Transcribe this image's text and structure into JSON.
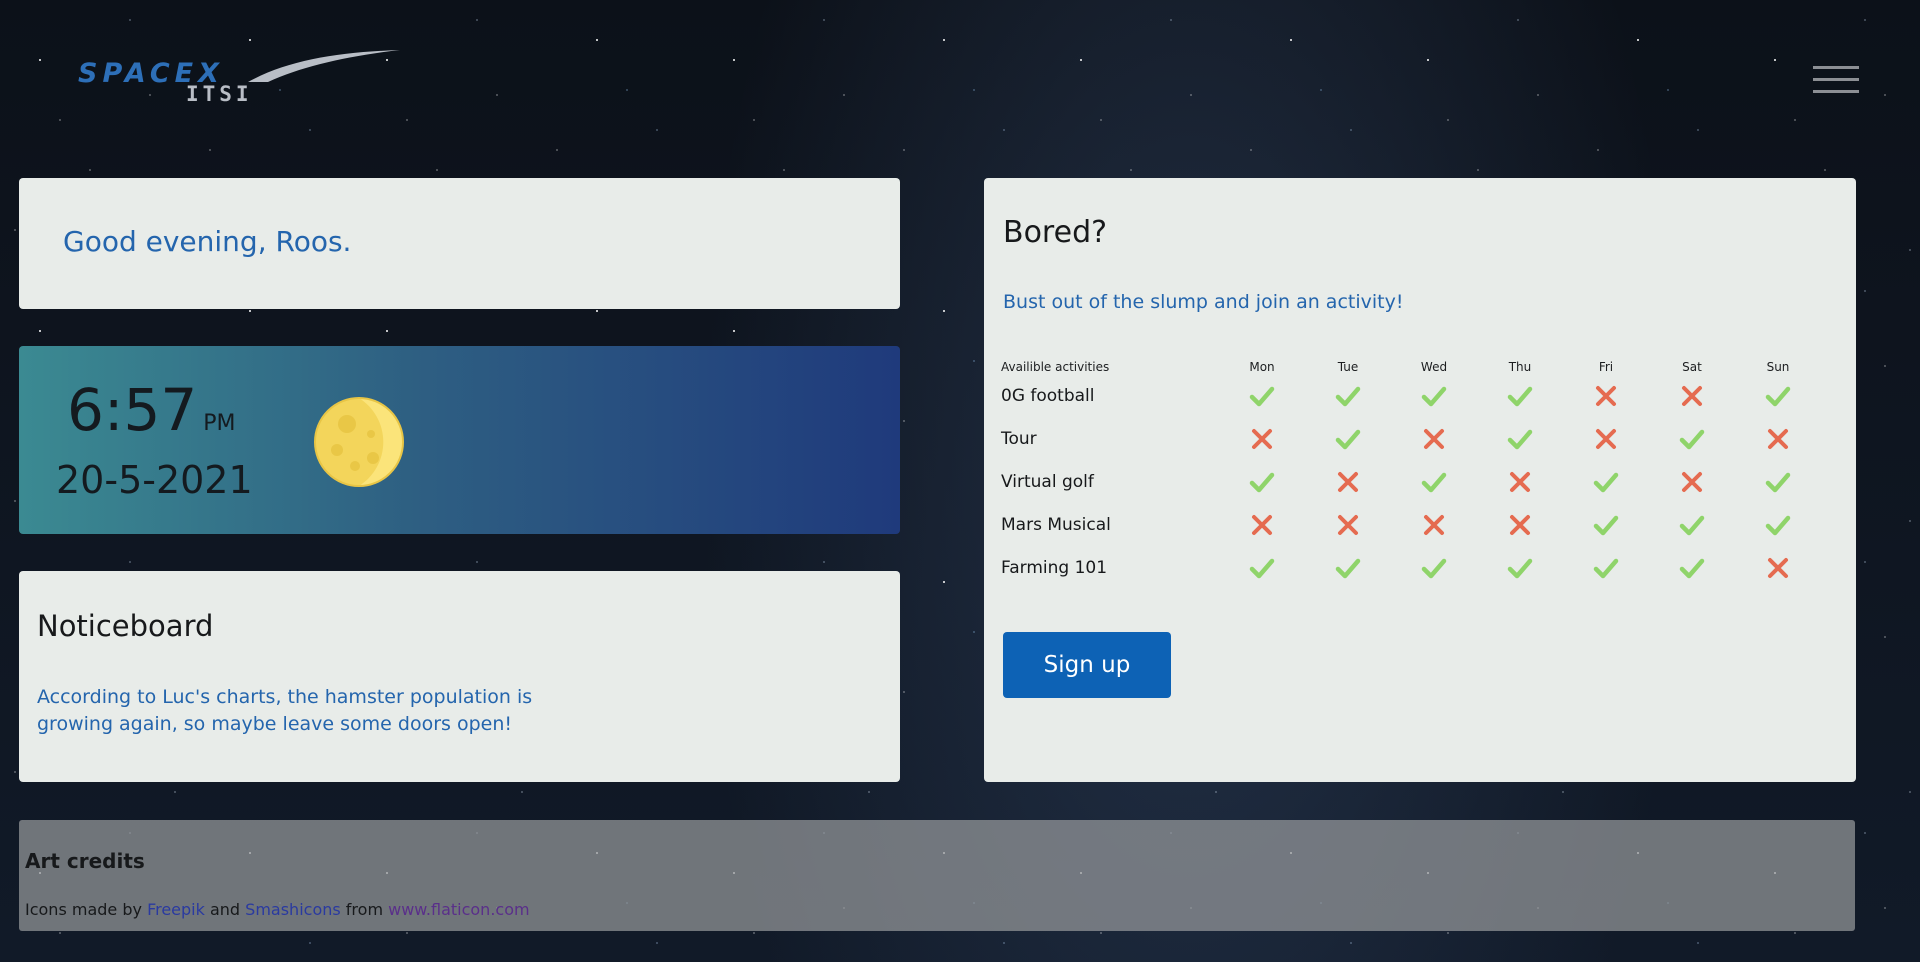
{
  "logo": {
    "main": "SPACEX",
    "sub": "ITSI"
  },
  "greeting": {
    "text": "Good evening, Roos."
  },
  "clock": {
    "time": "6:57",
    "ampm": "PM",
    "date": "20-5-2021",
    "icon": "moon-icon"
  },
  "notice": {
    "title": "Noticeboard",
    "text": "According to Luc's charts, the hamster population is growing again, so maybe leave some doors open!"
  },
  "activities": {
    "title": "Bored?",
    "subtitle": "Bust out of the slump and join an activity!",
    "header": "Availible activities",
    "days": [
      "Mon",
      "Tue",
      "Wed",
      "Thu",
      "Fri",
      "Sat",
      "Sun"
    ],
    "rows": [
      {
        "name": "0G football",
        "available": [
          true,
          true,
          true,
          true,
          false,
          false,
          true
        ]
      },
      {
        "name": "Tour",
        "available": [
          false,
          true,
          false,
          true,
          false,
          true,
          false
        ]
      },
      {
        "name": "Virtual golf",
        "available": [
          true,
          false,
          true,
          false,
          true,
          false,
          true
        ]
      },
      {
        "name": "Mars Musical",
        "available": [
          false,
          false,
          false,
          false,
          true,
          true,
          true
        ]
      },
      {
        "name": "Farming 101",
        "available": [
          true,
          true,
          true,
          true,
          true,
          true,
          false
        ]
      }
    ],
    "signup_label": "Sign up"
  },
  "credits": {
    "title": "Art credits",
    "prefix": "Icons made by ",
    "author1": "Freepik",
    "mid1": " and ",
    "author2": "Smashicons",
    "mid2": " from ",
    "site": "www.flaticon.com"
  },
  "colors": {
    "accent": "#2465ad",
    "button": "#0d62b5",
    "check": "#8fd46a",
    "cross": "#e56b50"
  }
}
